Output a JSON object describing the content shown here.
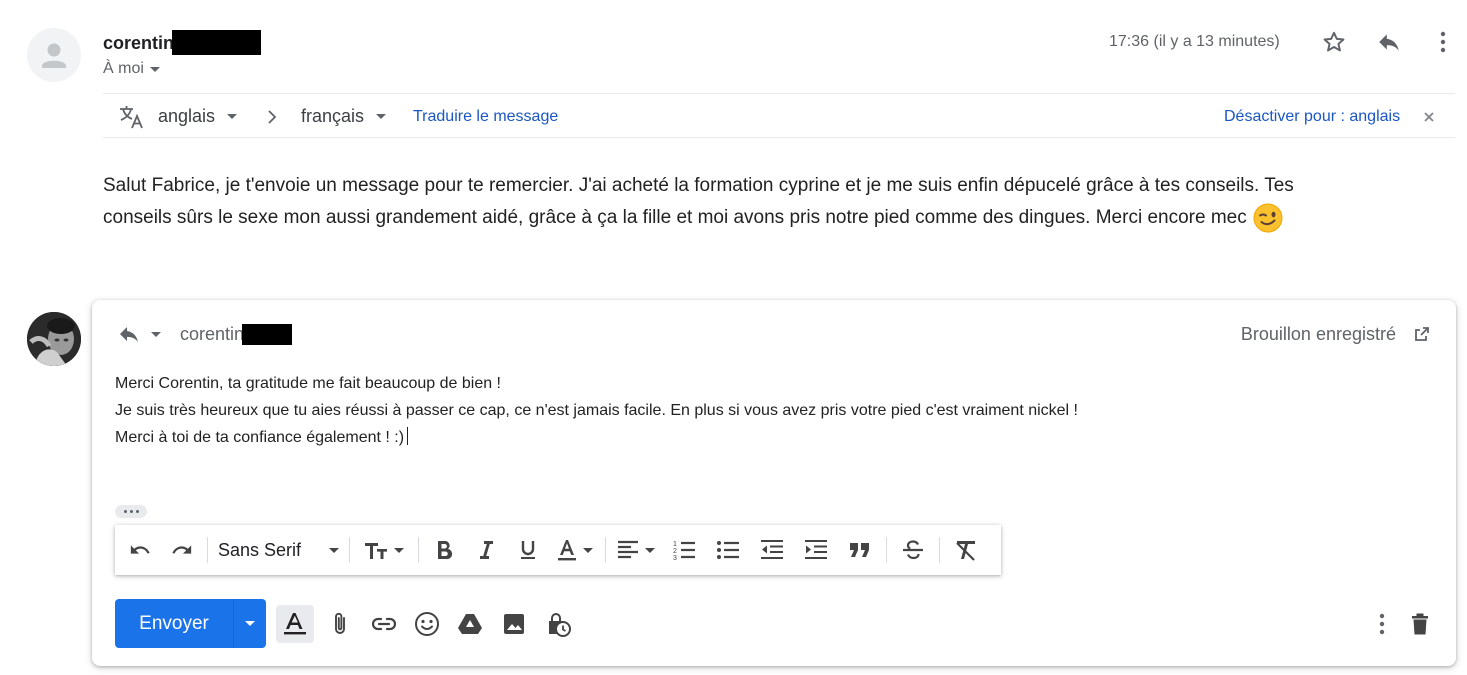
{
  "message": {
    "sender_name": "corentin",
    "recipient_label": "À moi",
    "timestamp": "17:36 (il y a 13 minutes)",
    "body_line1": "Salut Fabrice, je t'envoie un message pour te remercier. J'ai acheté la formation cyprine et je me suis enfin dépucelé grâce à tes conseils.  Tes",
    "body_line2": "conseils sûrs le sexe mon aussi grandement aidé, grâce à ça la fille et moi avons pris notre pied comme des dingues. Merci encore mec"
  },
  "translate": {
    "source_lang": "anglais",
    "target_lang": "français",
    "translate_link": "Traduire le message",
    "disable_link": "Désactiver pour : anglais"
  },
  "reply": {
    "to_name": "corentin",
    "draft_status": "Brouillon enregistré",
    "line1": "Merci Corentin, ta gratitude me fait beaucoup de bien !",
    "line2": "Je suis très heureux que tu aies réussi à passer ce cap, ce n'est jamais facile. En plus si vous avez pris votre pied c'est vraiment nickel !",
    "line3": "Merci à toi de ta confiance également ! :)",
    "font_name": "Sans Serif",
    "send_label": "Envoyer"
  },
  "icons": {
    "header": [
      "star-icon",
      "reply-icon",
      "more-vert-icon"
    ],
    "formatting": [
      "undo-icon",
      "redo-icon",
      "text-size-icon",
      "bold-icon",
      "italic-icon",
      "underline-icon",
      "text-color-icon",
      "align-icon",
      "numbered-list-icon",
      "bulleted-list-icon",
      "indent-less-icon",
      "indent-more-icon",
      "quote-icon",
      "strikethrough-icon",
      "remove-formatting-icon"
    ],
    "compose_tools": [
      "formatting-options-icon",
      "attach-icon",
      "link-icon",
      "emoji-icon",
      "drive-icon",
      "photo-icon",
      "confidential-mode-icon",
      "more-vert-icon",
      "trash-icon"
    ]
  },
  "colors": {
    "send_button": "#1a73e8",
    "link": "#1a56c4",
    "redaction": "#000000"
  }
}
